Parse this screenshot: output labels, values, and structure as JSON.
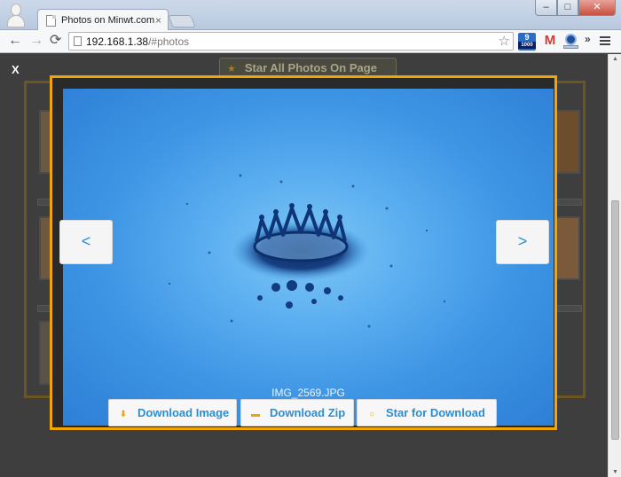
{
  "browser": {
    "tab_title": "Photos on Minwt.com",
    "tab_close": "×",
    "url_host": "192.168.1.38",
    "url_path": "/#photos",
    "window_buttons": {
      "minimize": "–",
      "maximize": "□",
      "close": "✕"
    },
    "nav": {
      "back": "←",
      "forward": "→",
      "reload": "⟳"
    },
    "bookmark_icon": "☆",
    "extensions": {
      "counter_top": "9",
      "counter_bottom": "1000",
      "gmail": "M"
    },
    "more_extensions": "»"
  },
  "page": {
    "close_label": "X",
    "star_all_label": "Star All Photos On Page",
    "star_all_icon": "★"
  },
  "lightbox": {
    "prev_label": "<",
    "next_label": ">",
    "caption": "IMG_2569.JPG",
    "buttons": {
      "download_image": "Download Image",
      "download_zip": "Download Zip",
      "star_download": "Star for Download"
    },
    "icons": {
      "download": "⬇",
      "folder": "▬",
      "star": "○"
    },
    "accent_color": "#f0a500",
    "link_color": "#2a8ed4"
  }
}
